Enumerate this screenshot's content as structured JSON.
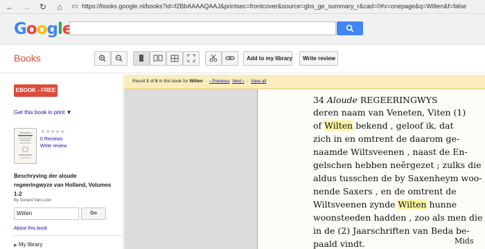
{
  "browser": {
    "url": "https://books.google.nl/books?id=f2BbAAAAQAAJ&printsec=frontcover&source=gbs_ge_summary_r&cad=0#v=onepage&q=Wilten&f=false",
    "icons": [
      "back-icon",
      "forward-icon",
      "reload-icon",
      "home-icon",
      "page-icon"
    ]
  },
  "header": {
    "logo_letters": [
      "G",
      "o",
      "o",
      "g",
      "l",
      "e"
    ],
    "logo_colors": [
      "#4285f4",
      "#ea4335",
      "#fbbc05",
      "#4285f4",
      "#34a853",
      "#ea4335"
    ],
    "search_icon": "search-icon"
  },
  "toolbar": {
    "section_title": "Books",
    "add_to_library": "Add to my library",
    "write_review": "Write review"
  },
  "sidebar": {
    "ebook_button": "EBOOK - FREE",
    "get_print": "Get this book in print ▼",
    "rating_stars": "★★★★★",
    "reviews": "0 Reviews",
    "write_review": "Write review",
    "book_title": "Beschryving der aloude regeeringwyze van Holland, Volumes 1-2",
    "author": "By Gerard Van Loon",
    "search_value": "Wilten",
    "go_button": "Go",
    "about": "About this book",
    "my_library": "My library"
  },
  "results": {
    "prefix": "Result",
    "index": "1",
    "of": "of",
    "total": "5",
    "mid": "in this book for",
    "query": "Wilten",
    "dash1": "-",
    "previous": "‹ Previous",
    "next": "Next ›",
    "dash2": "-",
    "view_all": "View all"
  },
  "page": {
    "lines": [
      [
        "34 ",
        "Aloude",
        " REGEERINGWYS"
      ],
      [
        "deren naam van Veneten, Viten (1)"
      ],
      [
        "of ",
        "Wilten",
        " bekend , geloof ik, dat"
      ],
      [
        "zich in en omtrent de daarom ge-"
      ],
      [
        "naamde Wiltsveenen , naast de En-"
      ],
      [
        "gelschen hebben neêrgezet ; zulks die"
      ],
      [
        "aldus tusschen de by Saxenheym woo-"
      ],
      [
        "nende Saxers , en de omtrent de"
      ],
      [
        "Wiltsveenen zynde ",
        "Wilten",
        " hunne"
      ],
      [
        "woonsteeden hadden , zoo als men die"
      ],
      [
        "in de (2) Jaarschriften van Beda be-"
      ],
      [
        "paald vindt."
      ]
    ],
    "catchword": "Mids"
  },
  "colors": {
    "accent_red": "#dd4b39",
    "link_blue": "#1a0dab",
    "google_blue": "#4285f4",
    "result_bar": "#f9edbe",
    "highlight": "#fdf6a0"
  }
}
